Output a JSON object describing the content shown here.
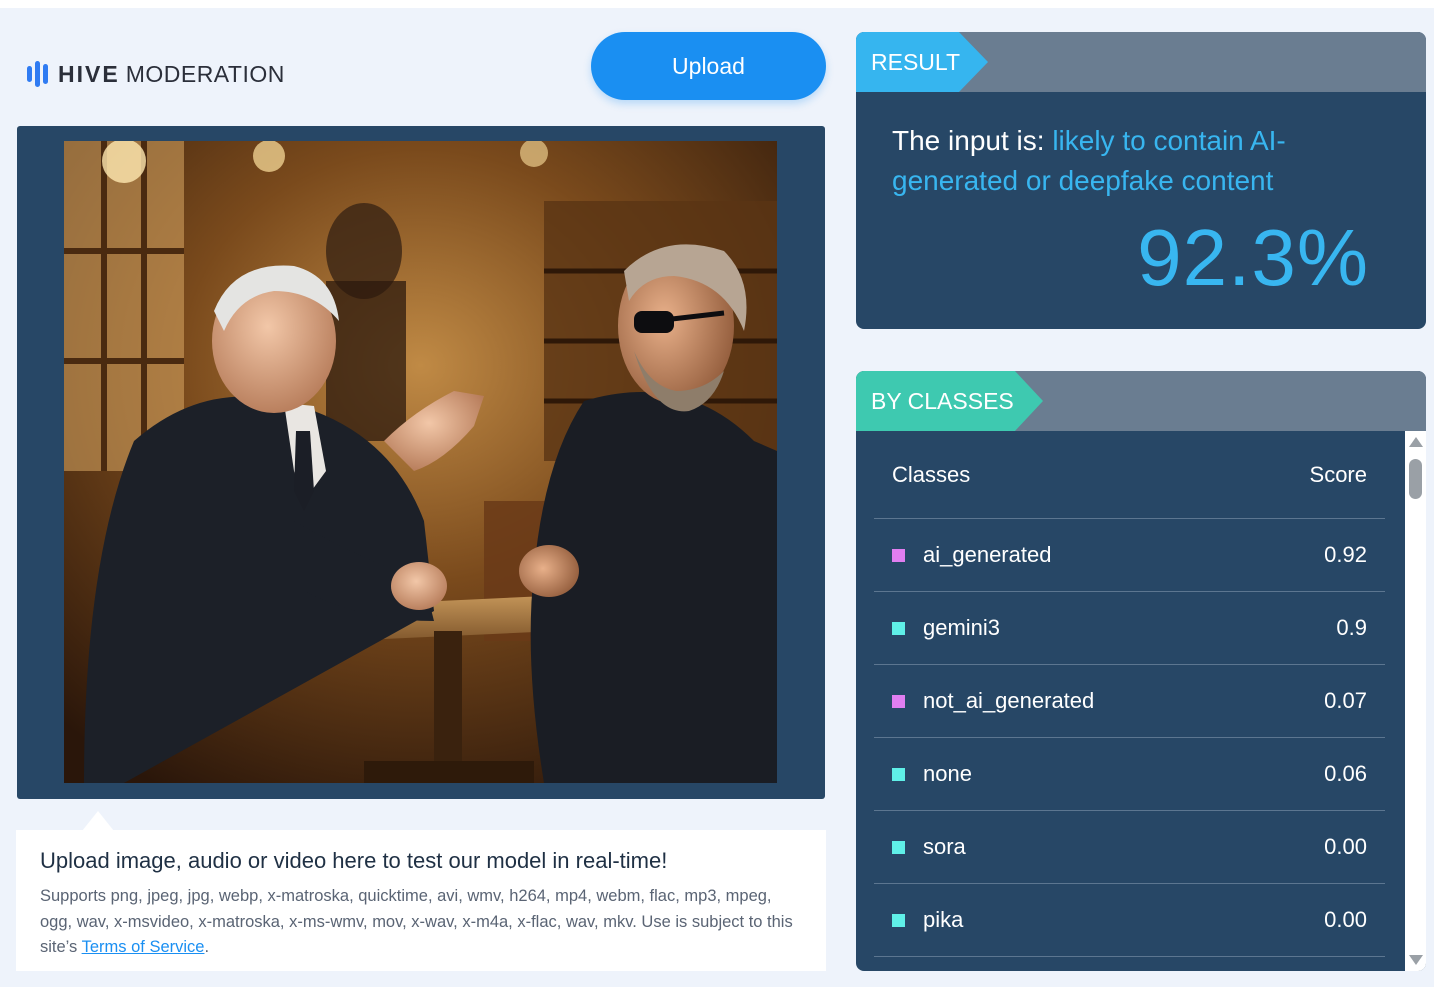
{
  "brand": {
    "strong": "HIVE",
    "light": "MODERATION"
  },
  "upload_button": {
    "label": "Upload"
  },
  "info": {
    "title": "Upload image, audio or video here to test our model in real-time!",
    "description": "Supports png, jpeg, jpg, webp, x-matroska, quicktime, avi, wmv, h264, mp4, webm, flac, mp3, mpeg, ogg, wav, x-msvideo, x-matroska, x-ms-wmv, mov, x-wav, x-m4a, x-flac, wav, mkv. Use is subject to this site’s ",
    "link": "Terms of Service",
    "after_link": "."
  },
  "result": {
    "header": "RESULT",
    "prefix": "The input is: ",
    "verdict": "likely to contain AI-generated or deepfake content",
    "percentage": "92.3%"
  },
  "classes": {
    "header": "BY CLASSES",
    "col_class": "Classes",
    "col_score": "Score",
    "rows": [
      {
        "name": "ai_generated",
        "score": "0.92",
        "color": "#e07ef0"
      },
      {
        "name": "gemini3",
        "score": "0.9",
        "color": "#5ff0e8"
      },
      {
        "name": "not_ai_generated",
        "score": "0.07",
        "color": "#e07ef0"
      },
      {
        "name": "none",
        "score": "0.06",
        "color": "#5ff0e8"
      },
      {
        "name": "sora",
        "score": "0.00",
        "color": "#5ff0e8"
      },
      {
        "name": "pika",
        "score": "0.00",
        "color": "#5ff0e8"
      }
    ]
  },
  "colors": {
    "accent_blue": "#1a8ff2",
    "result_blue": "#38b6f0",
    "classes_teal": "#3ec9b0",
    "panel_navy": "#274766"
  }
}
